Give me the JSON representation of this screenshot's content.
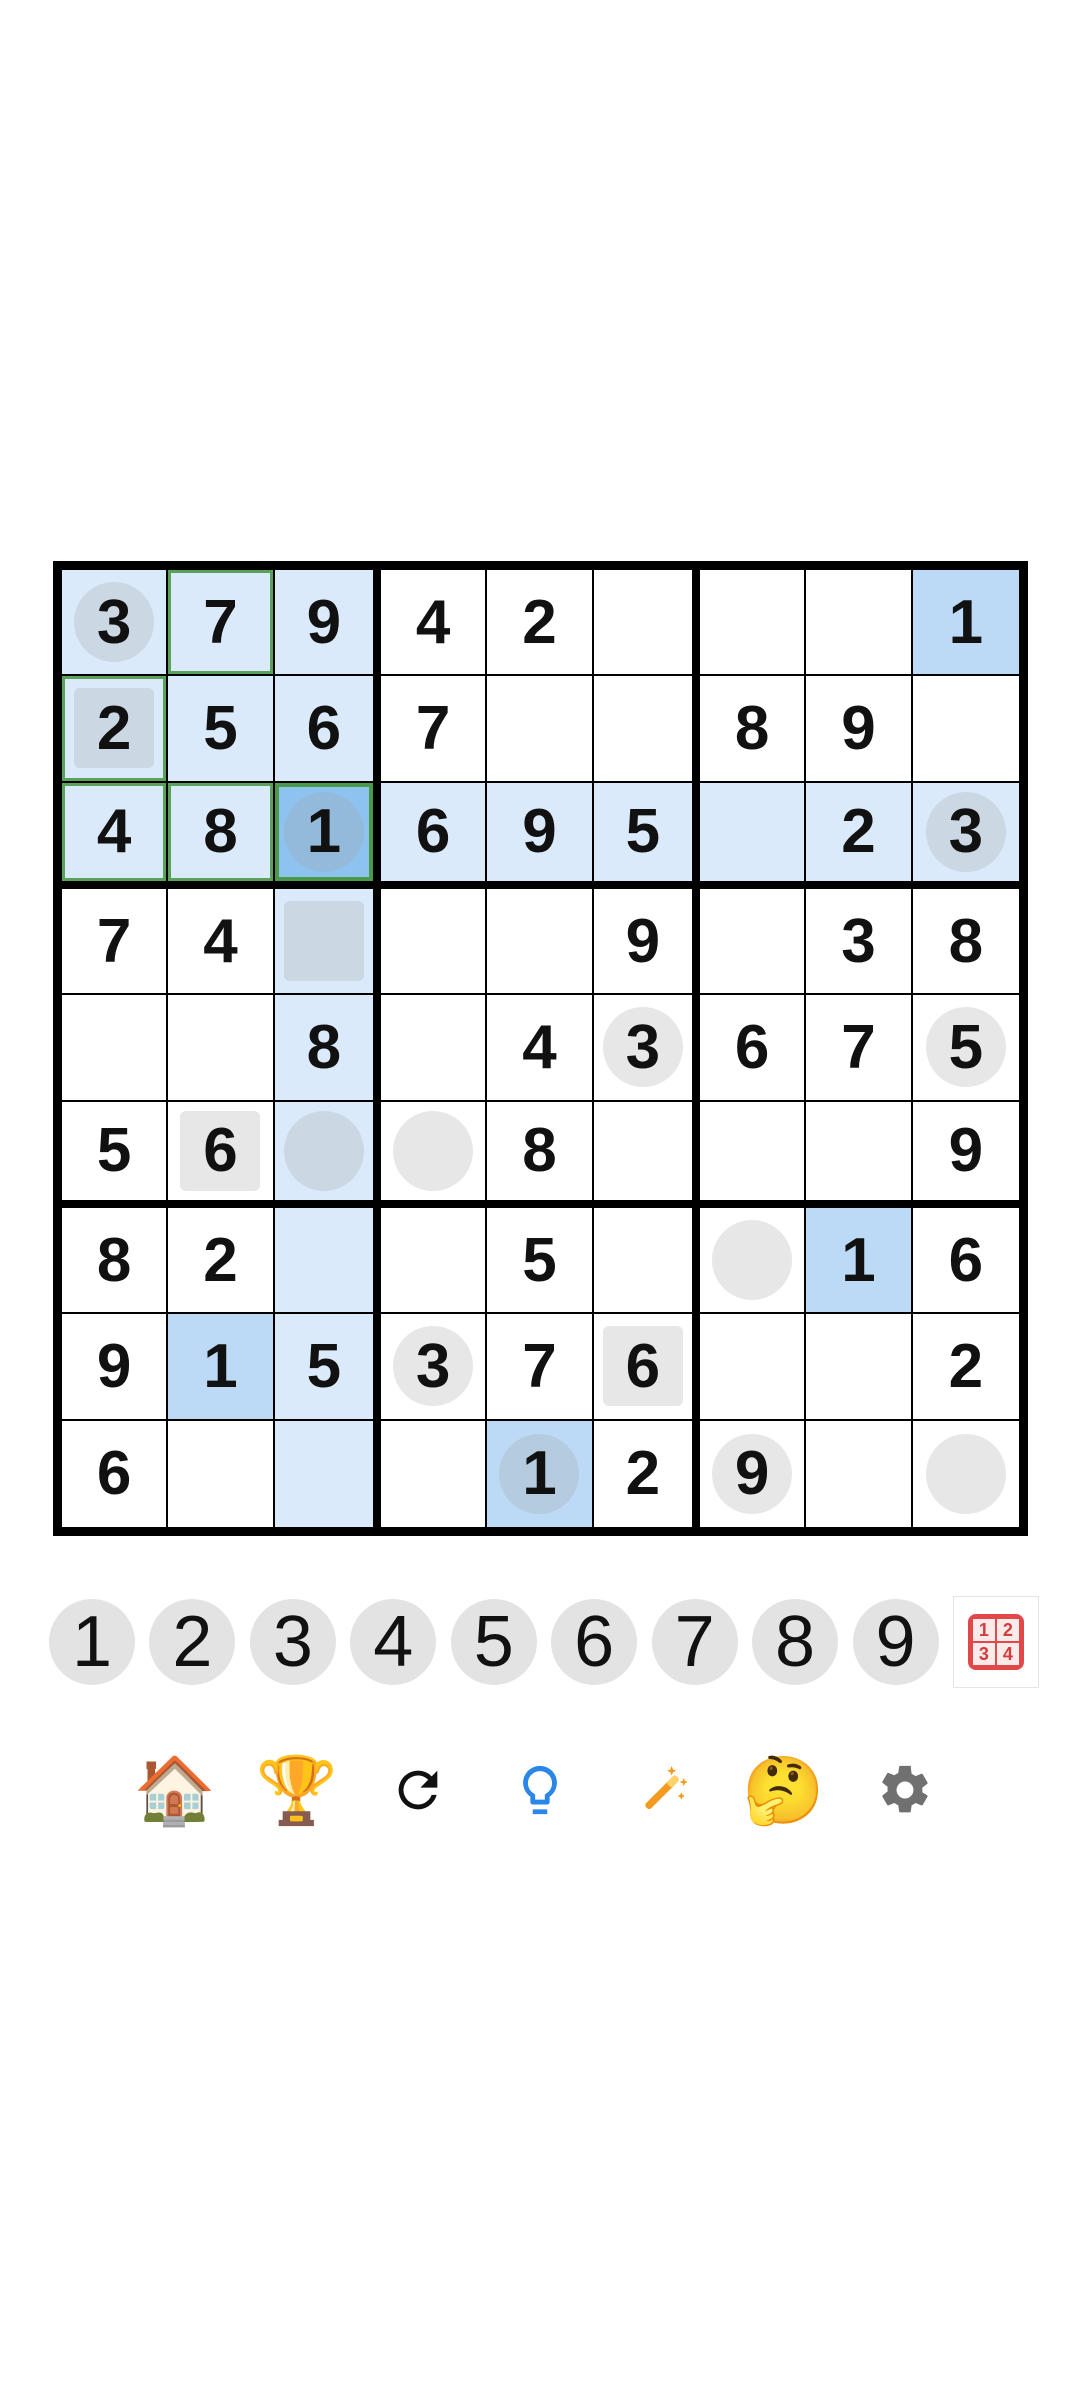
{
  "board": {
    "rows": [
      [
        "3",
        "7",
        "9",
        "4",
        "2",
        "",
        "",
        "",
        "1"
      ],
      [
        "2",
        "5",
        "6",
        "7",
        "",
        "",
        "8",
        "9",
        ""
      ],
      [
        "4",
        "8",
        "1",
        "6",
        "9",
        "5",
        "",
        "2",
        "3"
      ],
      [
        "7",
        "4",
        "",
        "",
        "",
        "9",
        "",
        "3",
        "8"
      ],
      [
        "",
        "",
        "8",
        "",
        "4",
        "3",
        "6",
        "7",
        "5"
      ],
      [
        "5",
        "6",
        "",
        "",
        "8",
        "",
        "",
        "",
        "9"
      ],
      [
        "8",
        "2",
        "",
        "",
        "5",
        "",
        "",
        "1",
        "6"
      ],
      [
        "9",
        "1",
        "5",
        "3",
        "7",
        "6",
        "",
        "",
        "2"
      ],
      [
        "6",
        "",
        "",
        "",
        "1",
        "2",
        "9",
        "",
        ""
      ]
    ],
    "selected": [
      2,
      2
    ],
    "highlight": [
      [
        0,
        0
      ],
      [
        0,
        1
      ],
      [
        0,
        2
      ],
      [
        1,
        0
      ],
      [
        1,
        1
      ],
      [
        1,
        2
      ],
      [
        2,
        0
      ],
      [
        2,
        1
      ],
      [
        2,
        3
      ],
      [
        2,
        4
      ],
      [
        2,
        5
      ],
      [
        2,
        6
      ],
      [
        2,
        7
      ],
      [
        2,
        8
      ],
      [
        3,
        2
      ],
      [
        4,
        2
      ],
      [
        5,
        2
      ],
      [
        6,
        2
      ],
      [
        7,
        2
      ],
      [
        8,
        2
      ]
    ],
    "strong": [
      [
        0,
        8
      ],
      [
        6,
        7
      ],
      [
        7,
        1
      ],
      [
        8,
        4
      ]
    ],
    "green_outline": [
      [
        0,
        1
      ],
      [
        1,
        0
      ],
      [
        2,
        0
      ],
      [
        2,
        1
      ]
    ],
    "circle_marks": [
      [
        0,
        0
      ],
      [
        2,
        2
      ],
      [
        2,
        8
      ],
      [
        4,
        5
      ],
      [
        4,
        8
      ],
      [
        5,
        2
      ],
      [
        5,
        3
      ],
      [
        6,
        6
      ],
      [
        7,
        3
      ],
      [
        8,
        4
      ],
      [
        8,
        6
      ],
      [
        8,
        8
      ]
    ],
    "square_marks": [
      [
        1,
        0
      ],
      [
        3,
        2
      ],
      [
        5,
        1
      ],
      [
        7,
        5
      ]
    ]
  },
  "numpad": {
    "digits": [
      "1",
      "2",
      "3",
      "4",
      "5",
      "6",
      "7",
      "8",
      "9"
    ],
    "mode_icon": "notes-mode-icon",
    "mode_digits": [
      "1",
      "2",
      "3",
      "4"
    ]
  },
  "toolbar": {
    "home": "🏠",
    "trophy": "🏆",
    "thinking": "🤔",
    "icons": [
      "home-icon",
      "trophy-icon",
      "restart-icon",
      "hint-bulb-icon",
      "magic-wand-icon",
      "thinking-face-icon",
      "settings-gear-icon"
    ]
  },
  "colors": {
    "highlight": "#dbeafb",
    "strong_highlight": "#bcdaf6",
    "selected": "#8fc3ef",
    "green_outline": "#5aa25a",
    "numpad_bg": "#e3e3e3",
    "hint_blue": "#2a86e8",
    "wand_orange": "#f39a1f",
    "gear_gray": "#707070"
  }
}
